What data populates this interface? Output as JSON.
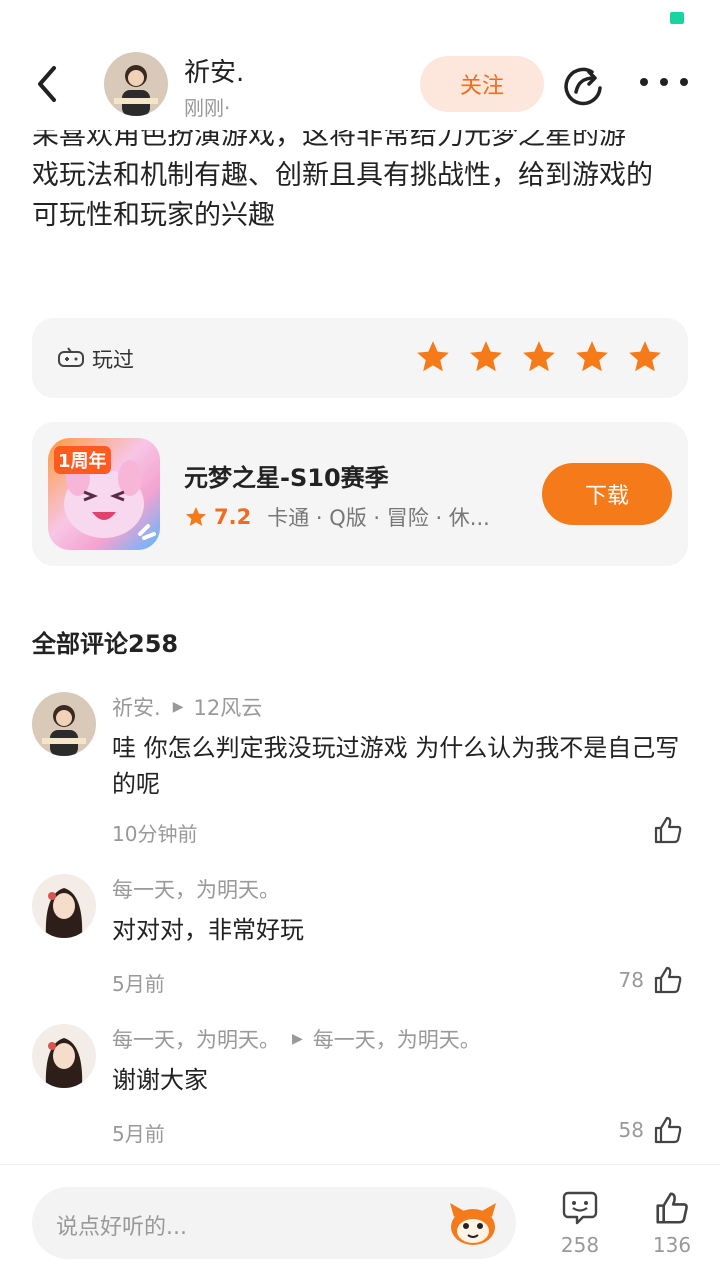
{
  "post": {
    "lines": [
      "呆喜欢角色扮演游戏，这将非常给力元梦之星的游",
      "戏玩法和机制有趣、创新且具有挑战性，给到游戏的",
      "可玩性和玩家的兴趣"
    ]
  },
  "header": {
    "author_name": "祈安.",
    "post_time": "刚刚·",
    "follow_label": "关注"
  },
  "review": {
    "played_label": "玩过",
    "stars": 5
  },
  "game": {
    "badge": "1周年",
    "title": "元梦之星-S10赛季",
    "rating": "7.2",
    "tags": "卡通 · Q版 · 冒险 · 休...",
    "download_label": "下载"
  },
  "comments_header": "全部评论258",
  "comments": [
    {
      "author": "祈安.",
      "reply_to": "12风云",
      "text": "哇 你怎么判定我没玩过游戏 为什么认为我不是自己写的呢",
      "time": "10分钟前",
      "likes": ""
    },
    {
      "author": "每一天，为明天。",
      "reply_to": "",
      "text": "对对对，非常好玩",
      "time": "5月前",
      "likes": "78"
    },
    {
      "author": "每一天，为明天。",
      "reply_to": "每一天，为明天。",
      "text": "谢谢大家",
      "time": "5月前",
      "likes": "58"
    }
  ],
  "bottom_bar": {
    "input_placeholder": "说点好听的...",
    "comment_count": "258",
    "like_count": "136"
  },
  "colors": {
    "accent": "#f57a19",
    "star": "#f57a19",
    "follow_bg": "#fde7dc",
    "card_bg": "#f5f5f5"
  }
}
